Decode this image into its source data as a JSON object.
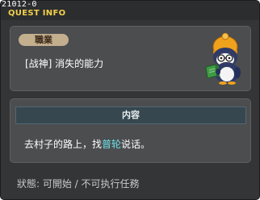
{
  "window": {
    "quest_id": "21012-0",
    "title": "QUEST INFO"
  },
  "job": {
    "badge": "職業",
    "text": "[战神] 消失的能力",
    "npc_icon": "penguin-reading-book-icon"
  },
  "content": {
    "header": "内容",
    "text_before": "去村子的路上，找",
    "npc_name": "普轮",
    "text_after": "说话。"
  },
  "status": {
    "text": "狀態: 可開始 / 不可执行任務"
  },
  "colors": {
    "title_yellow": "#f2d04b",
    "npc_highlight": "#6ee0e8",
    "panel": "#4b4d4f",
    "window_bg": "#333536"
  }
}
